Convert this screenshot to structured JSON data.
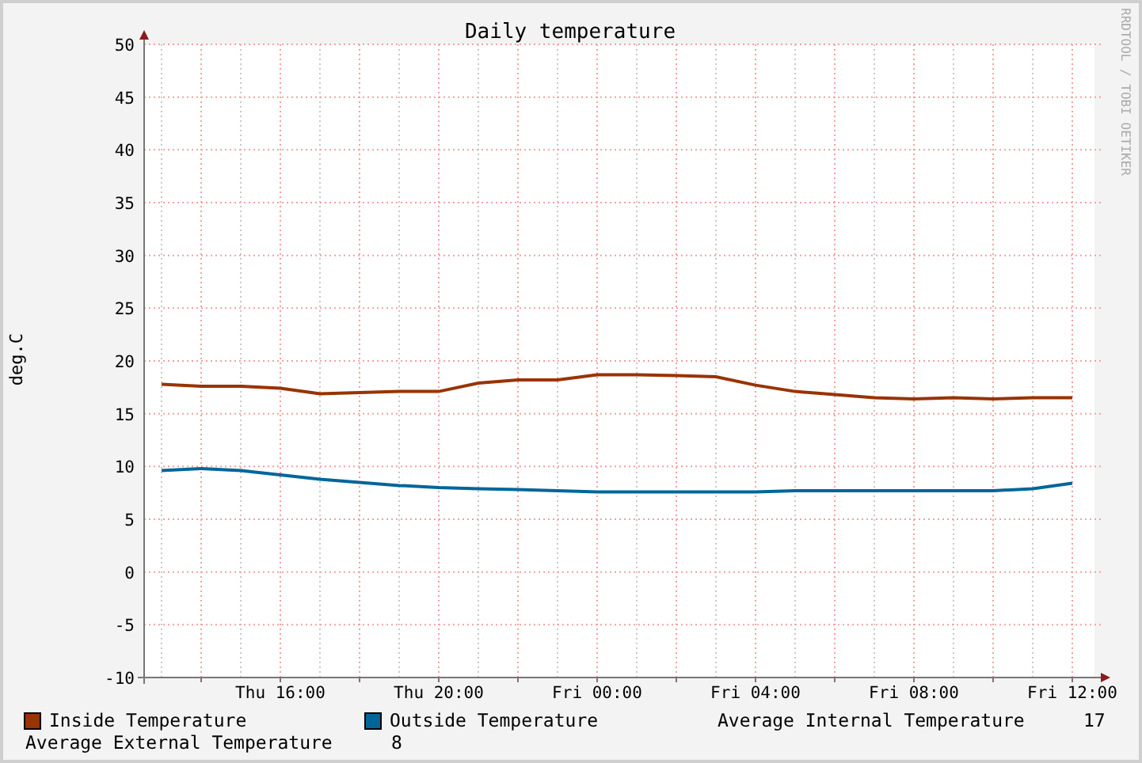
{
  "title": "Daily temperature",
  "credit": "RRDTOOL / TOBI OETIKER",
  "chart_data": {
    "type": "line",
    "ylabel": "deg.C",
    "grid": true,
    "ylim": [
      -10,
      50
    ],
    "yticks": [
      -10,
      -5,
      0,
      5,
      10,
      15,
      20,
      25,
      30,
      35,
      40,
      45,
      50
    ],
    "categories": [
      null,
      null,
      null,
      "Thu 16:00",
      null,
      null,
      null,
      "Thu 20:00",
      null,
      null,
      null,
      "Fri 00:00",
      null,
      null,
      null,
      "Fri 04:00",
      null,
      null,
      null,
      "Fri 08:00",
      null,
      null,
      null,
      "Fri 12:00"
    ],
    "series": [
      {
        "name": "Inside Temperature",
        "color": "#993300",
        "values": [
          17.8,
          17.6,
          17.6,
          17.4,
          16.9,
          17.0,
          17.1,
          17.1,
          17.9,
          18.2,
          18.2,
          18.7,
          18.7,
          18.6,
          18.5,
          17.7,
          17.1,
          16.8,
          16.5,
          16.4,
          16.5,
          16.4,
          16.5,
          16.5
        ]
      },
      {
        "name": "Outside Temperature",
        "color": "#006699",
        "values": [
          9.6,
          9.8,
          9.6,
          9.2,
          8.8,
          8.5,
          8.2,
          8.0,
          7.9,
          7.8,
          7.7,
          7.6,
          7.6,
          7.6,
          7.6,
          7.6,
          7.7,
          7.7,
          7.7,
          7.7,
          7.7,
          7.7,
          7.9,
          8.4
        ]
      }
    ]
  },
  "summary": [
    {
      "label": "Average Internal Temperature",
      "value": "17"
    },
    {
      "label": "Average External Temperature",
      "value": "8"
    }
  ]
}
